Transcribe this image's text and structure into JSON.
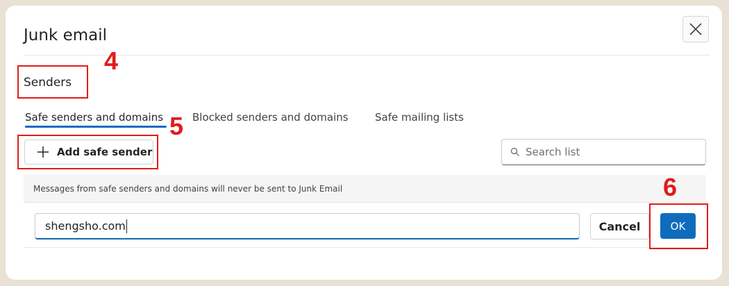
{
  "dialog": {
    "title": "Junk email",
    "close_icon": "close-icon"
  },
  "section": {
    "heading": "Senders"
  },
  "tabs": [
    {
      "label": "Safe senders and domains",
      "selected": true
    },
    {
      "label": "Blocked senders and domains",
      "selected": false
    },
    {
      "label": "Safe mailing lists",
      "selected": false
    }
  ],
  "toolbar": {
    "add_label": "Add safe sender",
    "add_icon": "plus-icon",
    "search_placeholder": "Search list",
    "search_icon": "search-icon"
  },
  "info": {
    "message": "Messages from safe senders and domains will never be sent to Junk Email"
  },
  "entry": {
    "value": "shengsho.com",
    "cancel_label": "Cancel",
    "ok_label": "OK"
  },
  "annotations": {
    "step_4": "4",
    "step_5": "5",
    "step_6": "6"
  },
  "colors": {
    "accent": "#0f6cbd",
    "annotation": "#e01c1c",
    "background": "#e9e1d6"
  }
}
